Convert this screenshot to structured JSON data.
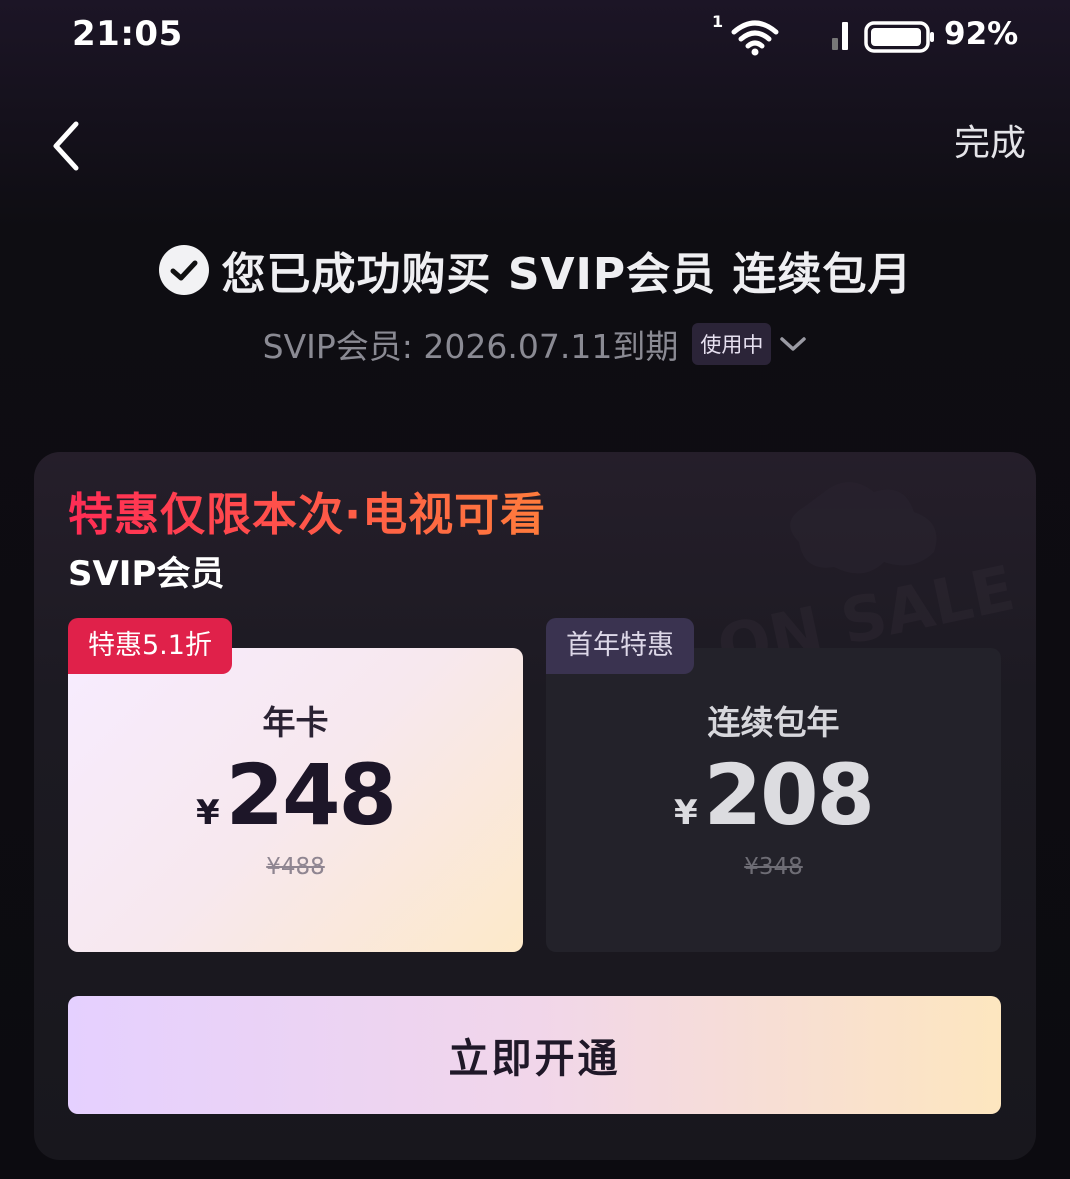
{
  "status_bar": {
    "time": "21:05",
    "sim_slot": "1",
    "battery": "92%"
  },
  "nav": {
    "done_label": "完成"
  },
  "success": {
    "message": "您已成功购买 SVIP会员 连续包月",
    "expiry": "SVIP会员: 2026.07.11到期",
    "status_badge": "使用中"
  },
  "offer": {
    "promo_title": "特惠仅限本次·电视可看",
    "plan_name": "SVIP会员",
    "decoration_text": "ON SALE",
    "plans": [
      {
        "tag": "特惠5.1折",
        "label": "年卡",
        "currency": "¥",
        "price": "248",
        "original_price": "¥488",
        "selected": true
      },
      {
        "tag": "首年特惠",
        "label": "连续包年",
        "currency": "¥",
        "price": "208",
        "original_price": "¥348",
        "selected": false
      }
    ],
    "cta_label": "立即开通"
  },
  "colors": {
    "accent_red": "#e0214a",
    "cta_gradient_start": "#e5d0ff",
    "cta_gradient_end": "#fde6bf",
    "background": "#0e0d12"
  }
}
